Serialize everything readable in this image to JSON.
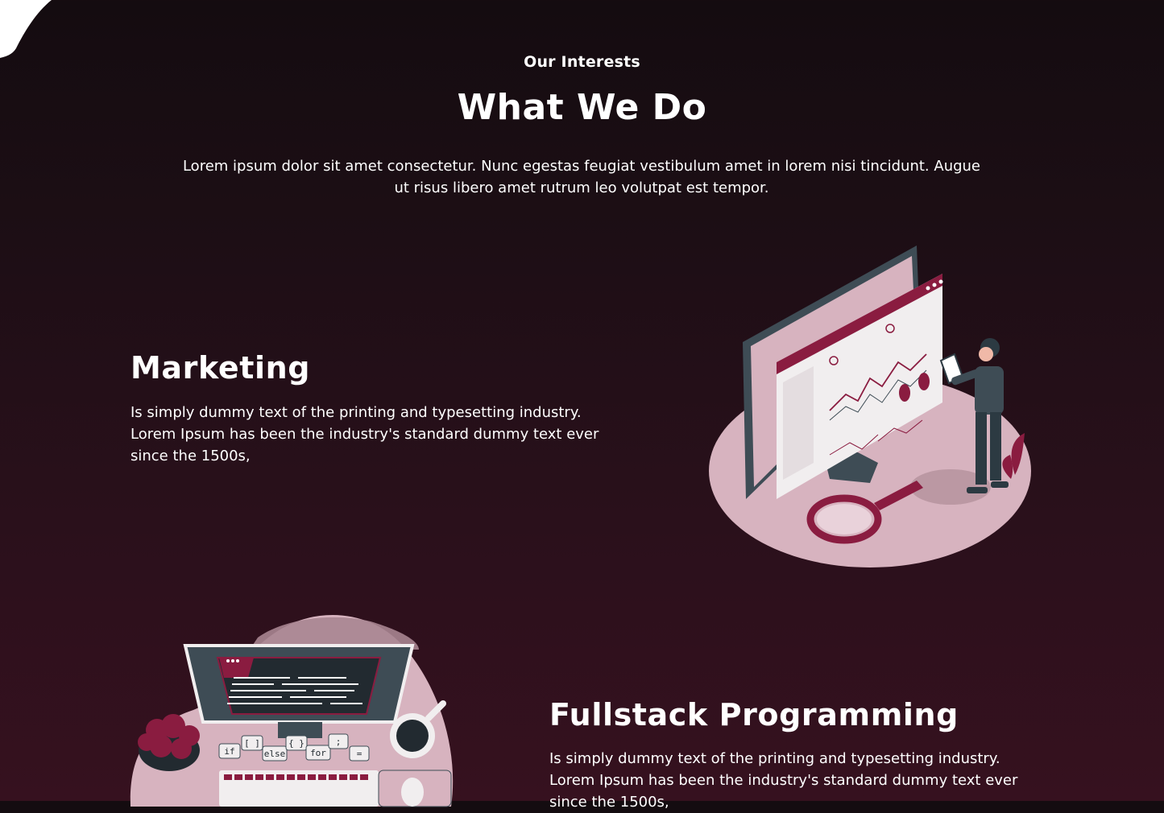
{
  "header": {
    "eyebrow": "Our Interests",
    "title": "What We Do",
    "intro": "Lorem ipsum dolor sit amet consectetur. Nunc egestas feugiat vestibulum amet in lorem nisi tincidunt. Augue ut risus libero amet rutrum leo volutpat est tempor."
  },
  "features": [
    {
      "title": "Marketing",
      "text": "Is simply dummy text of the printing and typesetting industry. Lorem Ipsum has been the industry's standard dummy text ever since the 1500s,",
      "illustration": "analytics-dashboard-illustration"
    },
    {
      "title": "Fullstack Programming",
      "text": "Is simply dummy text of the printing and typesetting industry. Lorem Ipsum has been the industry's standard dummy text ever since the 1500s,",
      "illustration": "coding-desk-illustration"
    }
  ],
  "illustration_labels": {
    "keys": [
      "if",
      "[ ]",
      "else",
      "{ }",
      "for",
      ";",
      "="
    ]
  },
  "colors": {
    "accent": "#8a1c40",
    "blob": "#d7b3bf",
    "background_top": "#140c10",
    "background_bottom": "#36111f"
  }
}
